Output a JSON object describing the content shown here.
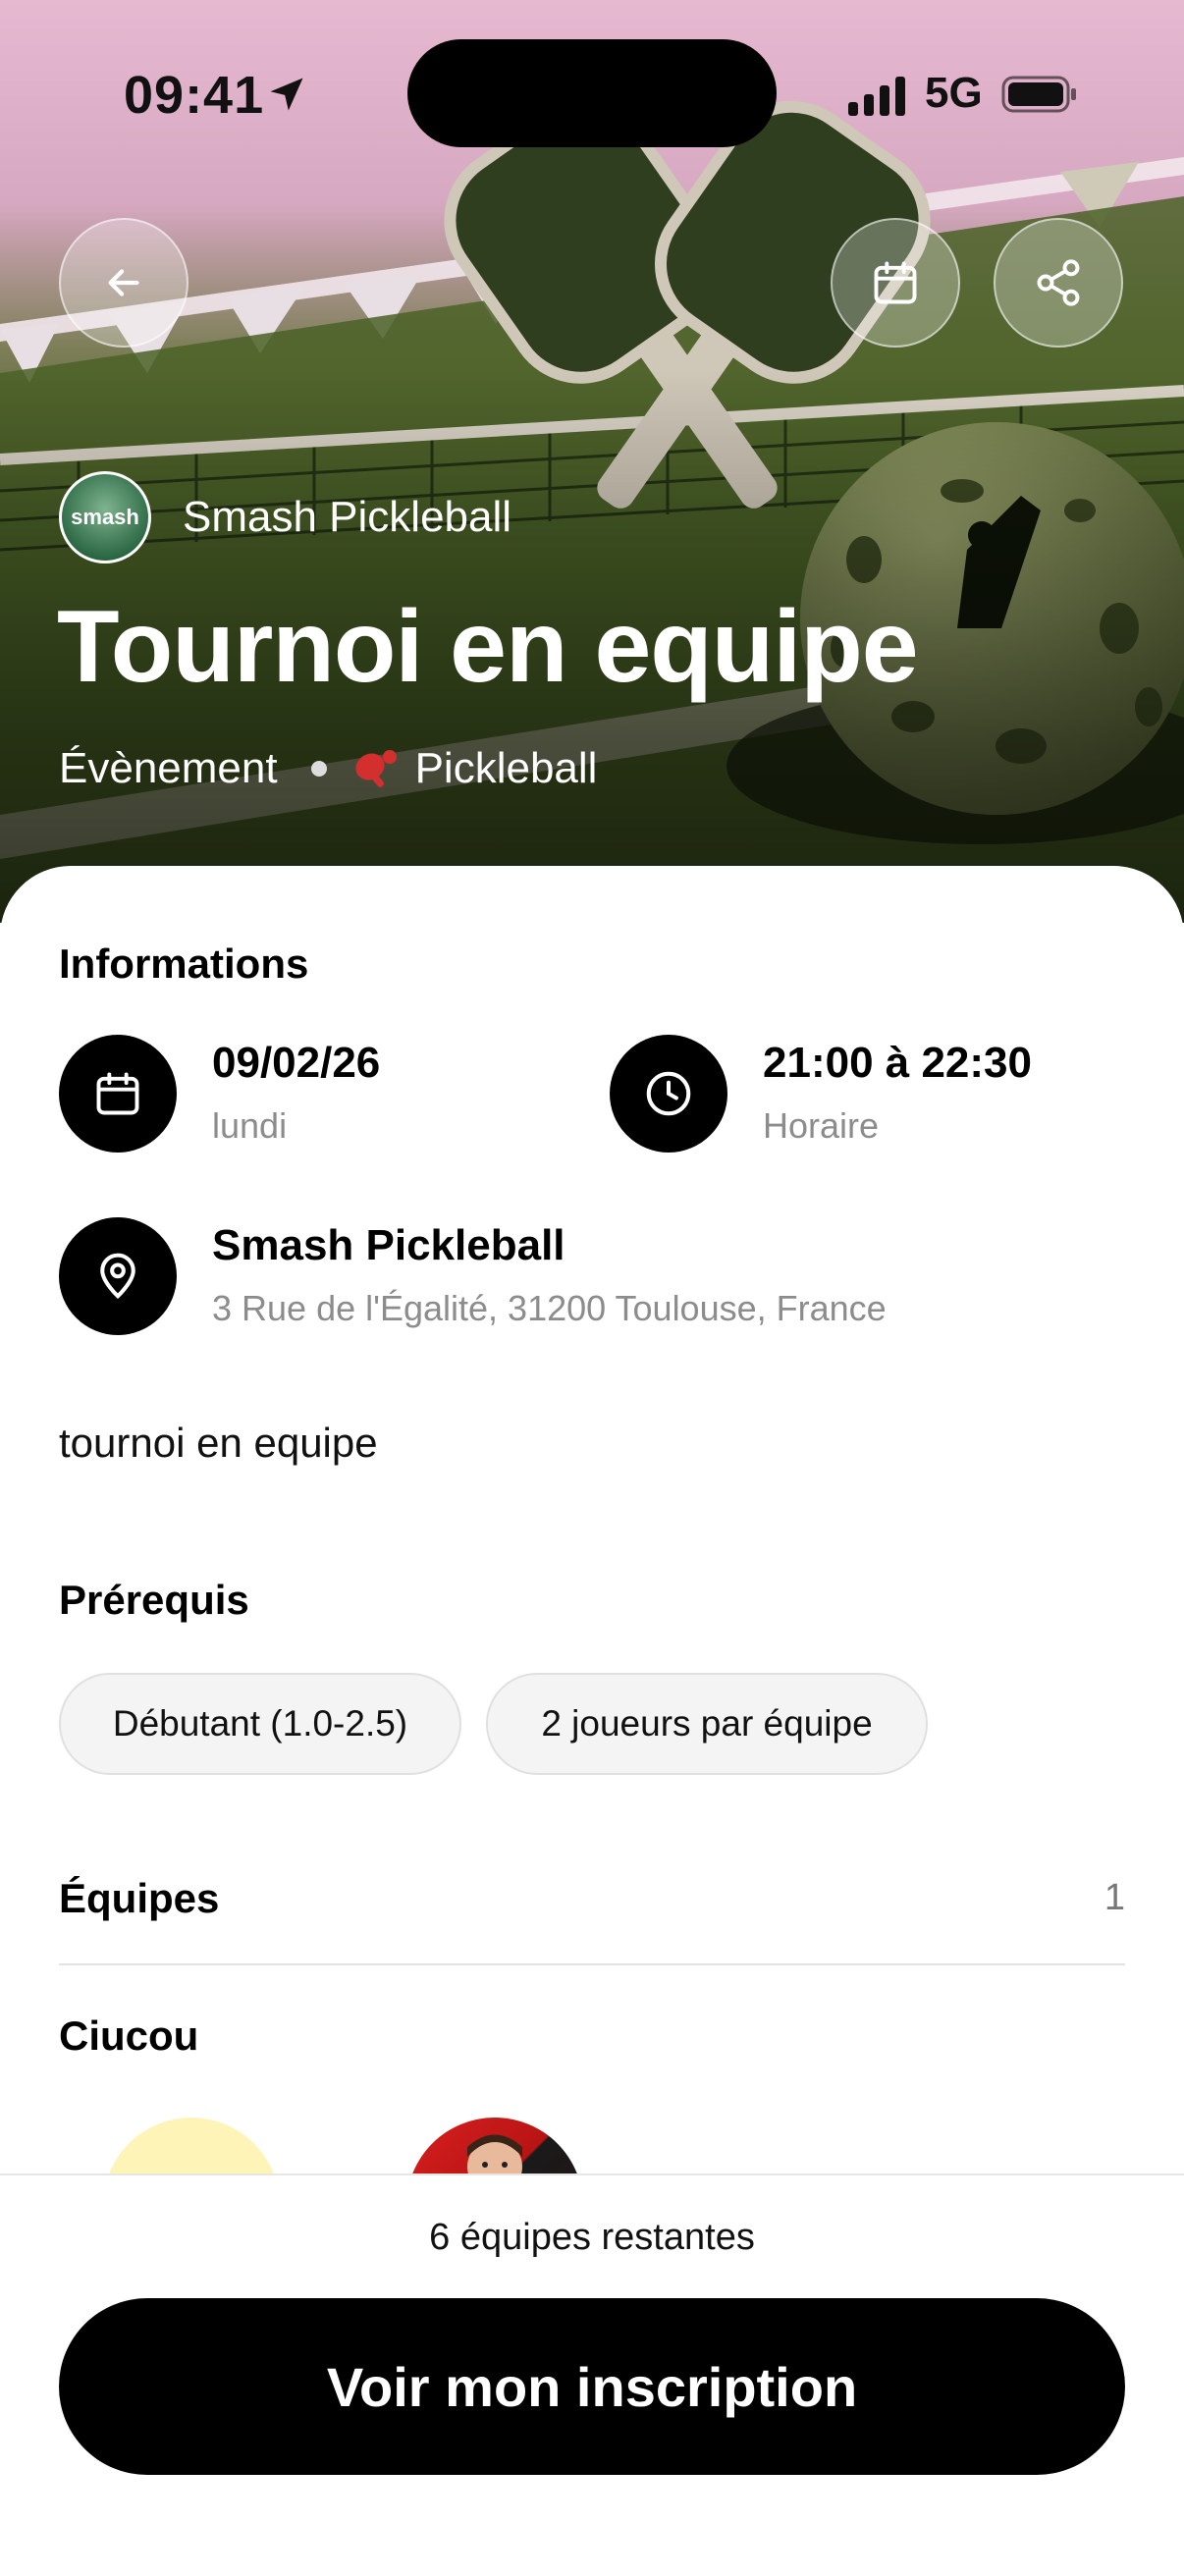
{
  "status_bar": {
    "time": "09:41",
    "network": "5G"
  },
  "hero": {
    "club_name": "Smash Pickleball",
    "club_logo_text": "smash",
    "title": "Tournoi en equipe",
    "category": "Évènement",
    "sport": "Pickleball"
  },
  "info": {
    "heading": "Informations",
    "date": "09/02/26",
    "weekday": "lundi",
    "time_range": "21:00 à 22:30",
    "time_label": "Horaire",
    "venue_name": "Smash Pickleball",
    "venue_address": "3 Rue de l'Égalité, 31200 Toulouse, France"
  },
  "description": "tournoi en equipe",
  "prerequisites": {
    "heading": "Prérequis",
    "chips": [
      "Débutant (1.0-2.5)",
      "2 joueurs par équipe"
    ]
  },
  "teams": {
    "heading": "Équipes",
    "count": "1",
    "team_name": "Ciucou"
  },
  "footer": {
    "remaining": "6 équipes restantes",
    "cta_label": "Voir mon inscription"
  },
  "colors": {
    "accent": "#000000",
    "sport_icon": "#d32f2f"
  }
}
